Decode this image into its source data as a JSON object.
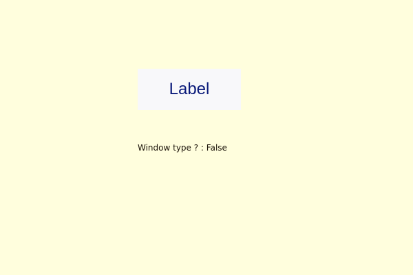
{
  "window": {
    "background_color": "#FFFEDD"
  },
  "label_widget": {
    "text": "Label",
    "background_color": "#F8F8FA",
    "text_color": "#0A1A7A"
  },
  "status": {
    "text": "Window type ? : False"
  }
}
